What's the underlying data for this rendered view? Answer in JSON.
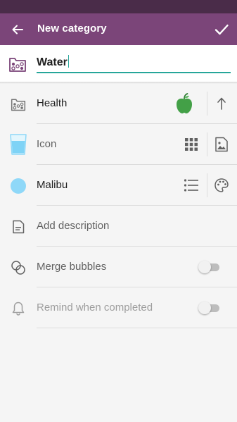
{
  "app_bar": {
    "title": "New category",
    "back_icon": "arrow-left-icon",
    "confirm_icon": "checkmark-icon"
  },
  "name_field": {
    "value": "Water",
    "icon": "category-grid-icon",
    "accent": "#26a69a"
  },
  "group_row": {
    "label": "Health",
    "icon": "category-grid-icon",
    "badge_icon": "apple-icon",
    "badge_color": "#43a047",
    "action_icon": "arrow-up-icon"
  },
  "icon_row": {
    "label": "Icon",
    "preview_icon": "water-glass-icon",
    "grid_icon": "grid-icon",
    "image_icon": "image-icon"
  },
  "color_row": {
    "label": "Malibu",
    "swatch": "#8fd8f8",
    "list_icon": "list-icon",
    "palette_icon": "palette-icon"
  },
  "description_row": {
    "label": "Add description",
    "icon": "document-icon"
  },
  "merge_row": {
    "label": "Merge bubbles",
    "icon": "bubbles-icon",
    "enabled": false
  },
  "remind_row": {
    "label": "Remind when completed",
    "icon": "bell-icon",
    "enabled": false
  },
  "colors": {
    "status_bar": "#4a2c49",
    "app_bar": "#7b4579",
    "background": "#f5f5f5"
  }
}
